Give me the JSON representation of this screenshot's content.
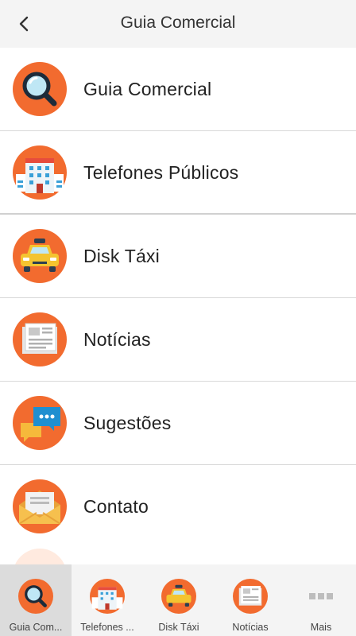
{
  "header": {
    "title": "Guia Comercial"
  },
  "colors": {
    "accent": "#f26b2f",
    "background": "#f4f4f4"
  },
  "menu": [
    {
      "label": "Guia Comercial",
      "icon": "magnifier-icon"
    },
    {
      "label": "Telefones Públicos",
      "icon": "building-icon"
    },
    {
      "label": "Disk Táxi",
      "icon": "taxi-icon"
    },
    {
      "label": "Notícias",
      "icon": "newspaper-icon"
    },
    {
      "label": "Sugestões",
      "icon": "chat-bubbles-icon"
    },
    {
      "label": "Contato",
      "icon": "envelope-icon"
    }
  ],
  "tabs": [
    {
      "label": "Guia Com...",
      "icon": "magnifier-icon",
      "active": true
    },
    {
      "label": "Telefones ...",
      "icon": "building-icon",
      "active": false
    },
    {
      "label": "Disk Táxi",
      "icon": "taxi-icon",
      "active": false
    },
    {
      "label": "Notícias",
      "icon": "newspaper-icon",
      "active": false
    },
    {
      "label": "Mais",
      "icon": "more-dots-icon",
      "active": false
    }
  ]
}
